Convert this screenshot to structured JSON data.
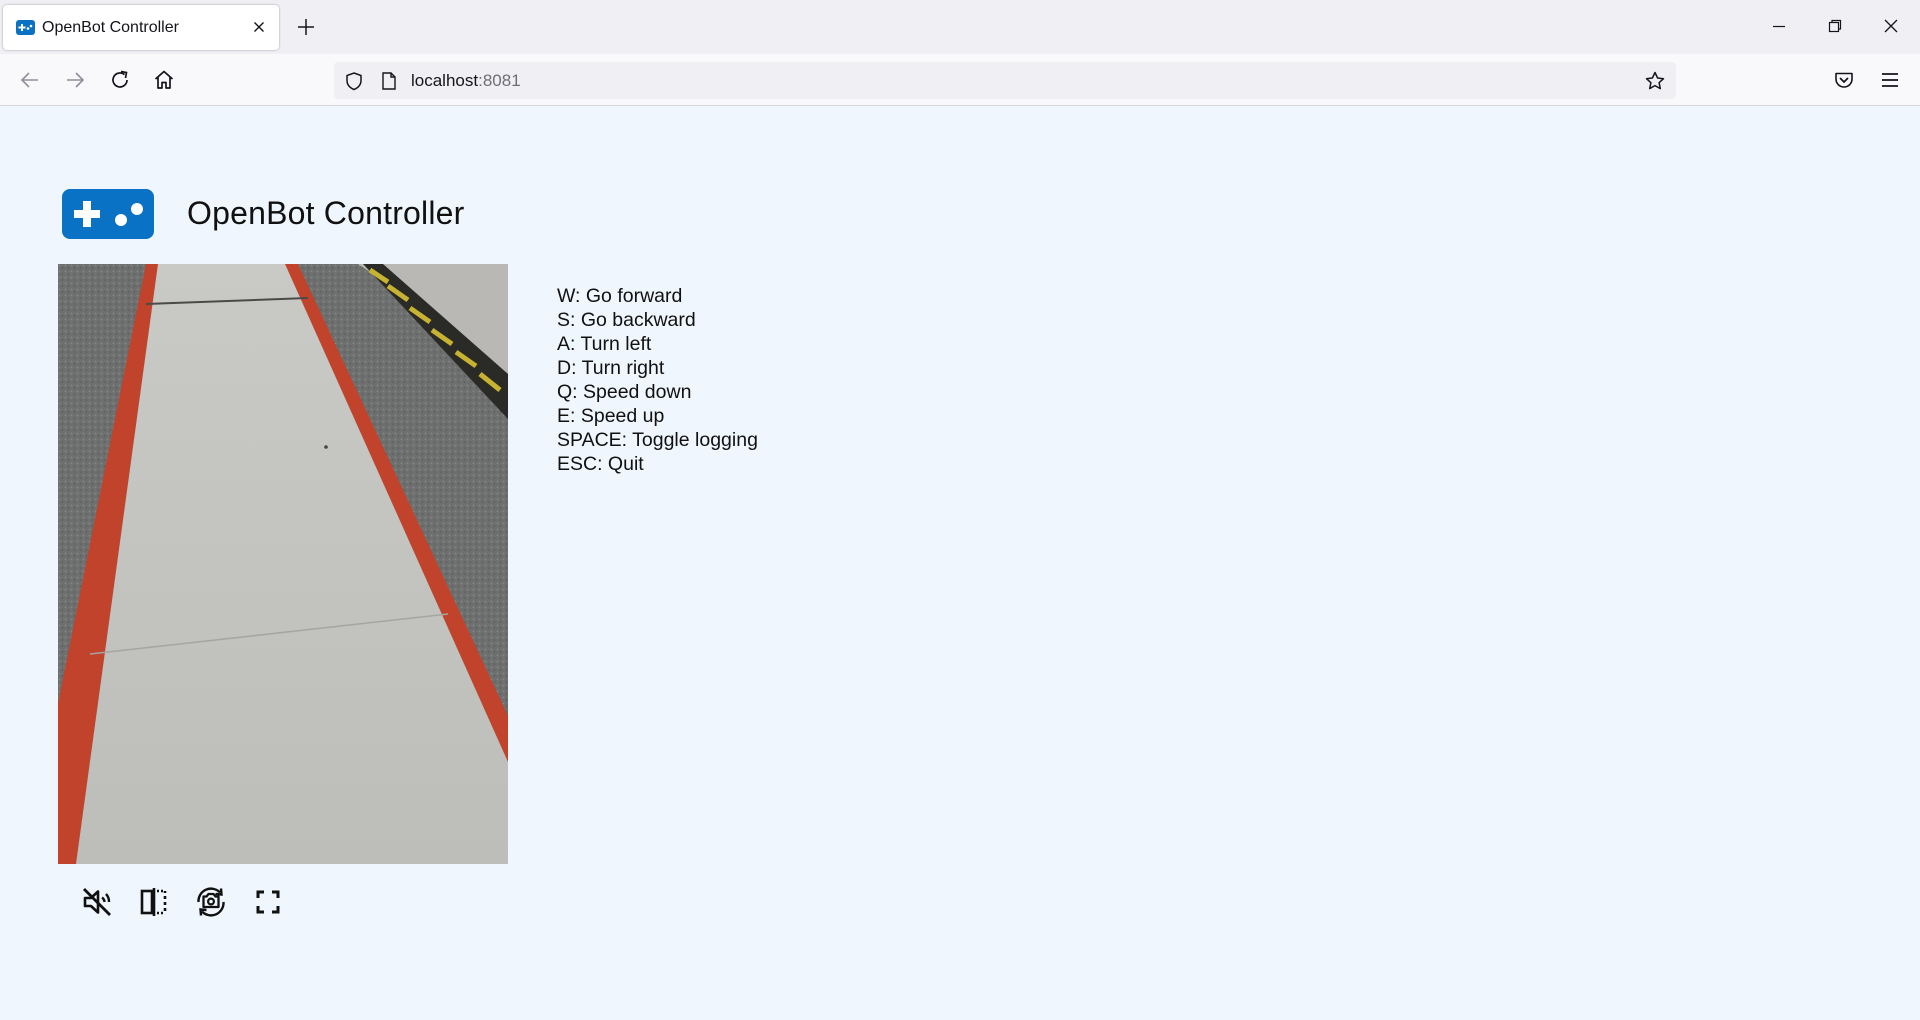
{
  "browser": {
    "tab": {
      "title": "OpenBot Controller"
    },
    "url": {
      "host": "localhost",
      "port": ":8081"
    }
  },
  "page": {
    "title": "OpenBot Controller",
    "video": {
      "description": ""
    },
    "controls": [
      {
        "name": "mute-icon"
      },
      {
        "name": "mirror-icon"
      },
      {
        "name": "switch-camera-icon"
      },
      {
        "name": "fullscreen-icon"
      }
    ],
    "help": [
      "W: Go forward",
      "S: Go backward",
      "A: Turn left",
      "D: Turn right",
      "Q: Speed down",
      "E: Speed up",
      "SPACE: Toggle logging",
      "ESC: Quit"
    ]
  },
  "colors": {
    "accent": "#0a72c4",
    "background": "#eff6fd"
  }
}
